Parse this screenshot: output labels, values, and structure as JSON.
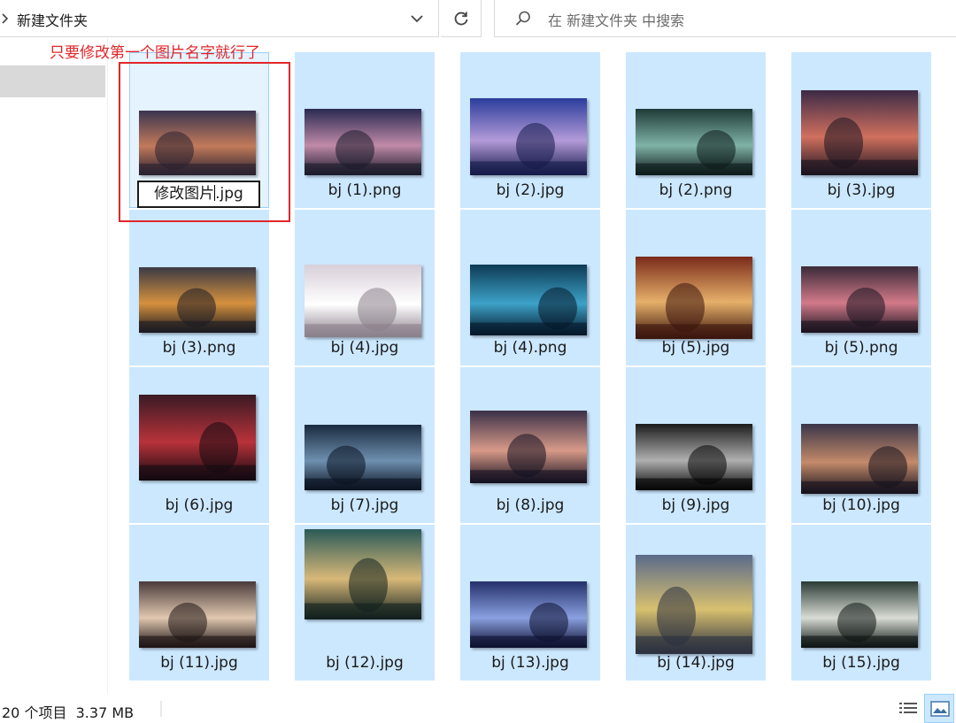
{
  "address_bar": {
    "path": "新建文件夹"
  },
  "search": {
    "placeholder": "在 新建文件夹 中搜索"
  },
  "annotation": {
    "text": "只要修改第一个图片名字就行了"
  },
  "files": [
    {
      "name": "修改图片.jpg",
      "renaming": true,
      "palette": [
        "#3b3550",
        "#c27a5a",
        "#2a2130"
      ]
    },
    {
      "name": "bj (1).png",
      "palette": [
        "#2a2a52",
        "#c08aa8",
        "#1a1a2a"
      ]
    },
    {
      "name": "bj (2).jpg",
      "palette": [
        "#2b3d9c",
        "#b39ad8",
        "#141a4a"
      ]
    },
    {
      "name": "bj (2).png",
      "palette": [
        "#1f3a38",
        "#7fb3a6",
        "#0d1a1a"
      ]
    },
    {
      "name": "bj (3).jpg",
      "palette": [
        "#3b2a46",
        "#d1705e",
        "#1a1420"
      ]
    },
    {
      "name": "bj (3).png",
      "palette": [
        "#3a3a44",
        "#d6913e",
        "#1b1b22"
      ]
    },
    {
      "name": "bj (4).jpg",
      "palette": [
        "#d8cfd8",
        "#ffffff",
        "#8a7f8a"
      ]
    },
    {
      "name": "bj (4).png",
      "palette": [
        "#0d3a54",
        "#3da2c8",
        "#05182a"
      ]
    },
    {
      "name": "bj (5).jpg",
      "palette": [
        "#7a2a1a",
        "#e6b06a",
        "#3a140d"
      ]
    },
    {
      "name": "bj (5).png",
      "palette": [
        "#3a2a38",
        "#d37a8a",
        "#1a1420"
      ]
    },
    {
      "name": "bj (6).jpg",
      "palette": [
        "#3a1a24",
        "#b8323a",
        "#140a10"
      ]
    },
    {
      "name": "bj (7).jpg",
      "palette": [
        "#1a2a3e",
        "#6e90b0",
        "#0a1220"
      ]
    },
    {
      "name": "bj (8).jpg",
      "palette": [
        "#3a3048",
        "#d89a88",
        "#141020"
      ]
    },
    {
      "name": "bj (9).jpg",
      "palette": [
        "#1c1c1c",
        "#b0b0b0",
        "#050505"
      ]
    },
    {
      "name": "bj (10).jpg",
      "palette": [
        "#3a3548",
        "#c48a6a",
        "#15121d"
      ]
    },
    {
      "name": "bj (11).jpg",
      "palette": [
        "#4a3a3a",
        "#e0c8b0",
        "#1e1414"
      ]
    },
    {
      "name": "bj (12).jpg",
      "palette": [
        "#2a5a58",
        "#d8b878",
        "#10201e"
      ]
    },
    {
      "name": "bj (13).jpg",
      "palette": [
        "#24306a",
        "#8aa0e0",
        "#0d1030"
      ]
    },
    {
      "name": "bj (14).jpg",
      "palette": [
        "#5a6a8a",
        "#d8c070",
        "#2a3040"
      ]
    },
    {
      "name": "bj (15).jpg",
      "palette": [
        "#2a3a34",
        "#d8dcd4",
        "#0d1412"
      ]
    }
  ],
  "status_bar": {
    "item_count": "20 个项目",
    "size": "3.37 MB"
  },
  "colors": {
    "selection": "#cce8ff",
    "focus_border": "#99d1ff",
    "annotation": "#e0262a"
  }
}
